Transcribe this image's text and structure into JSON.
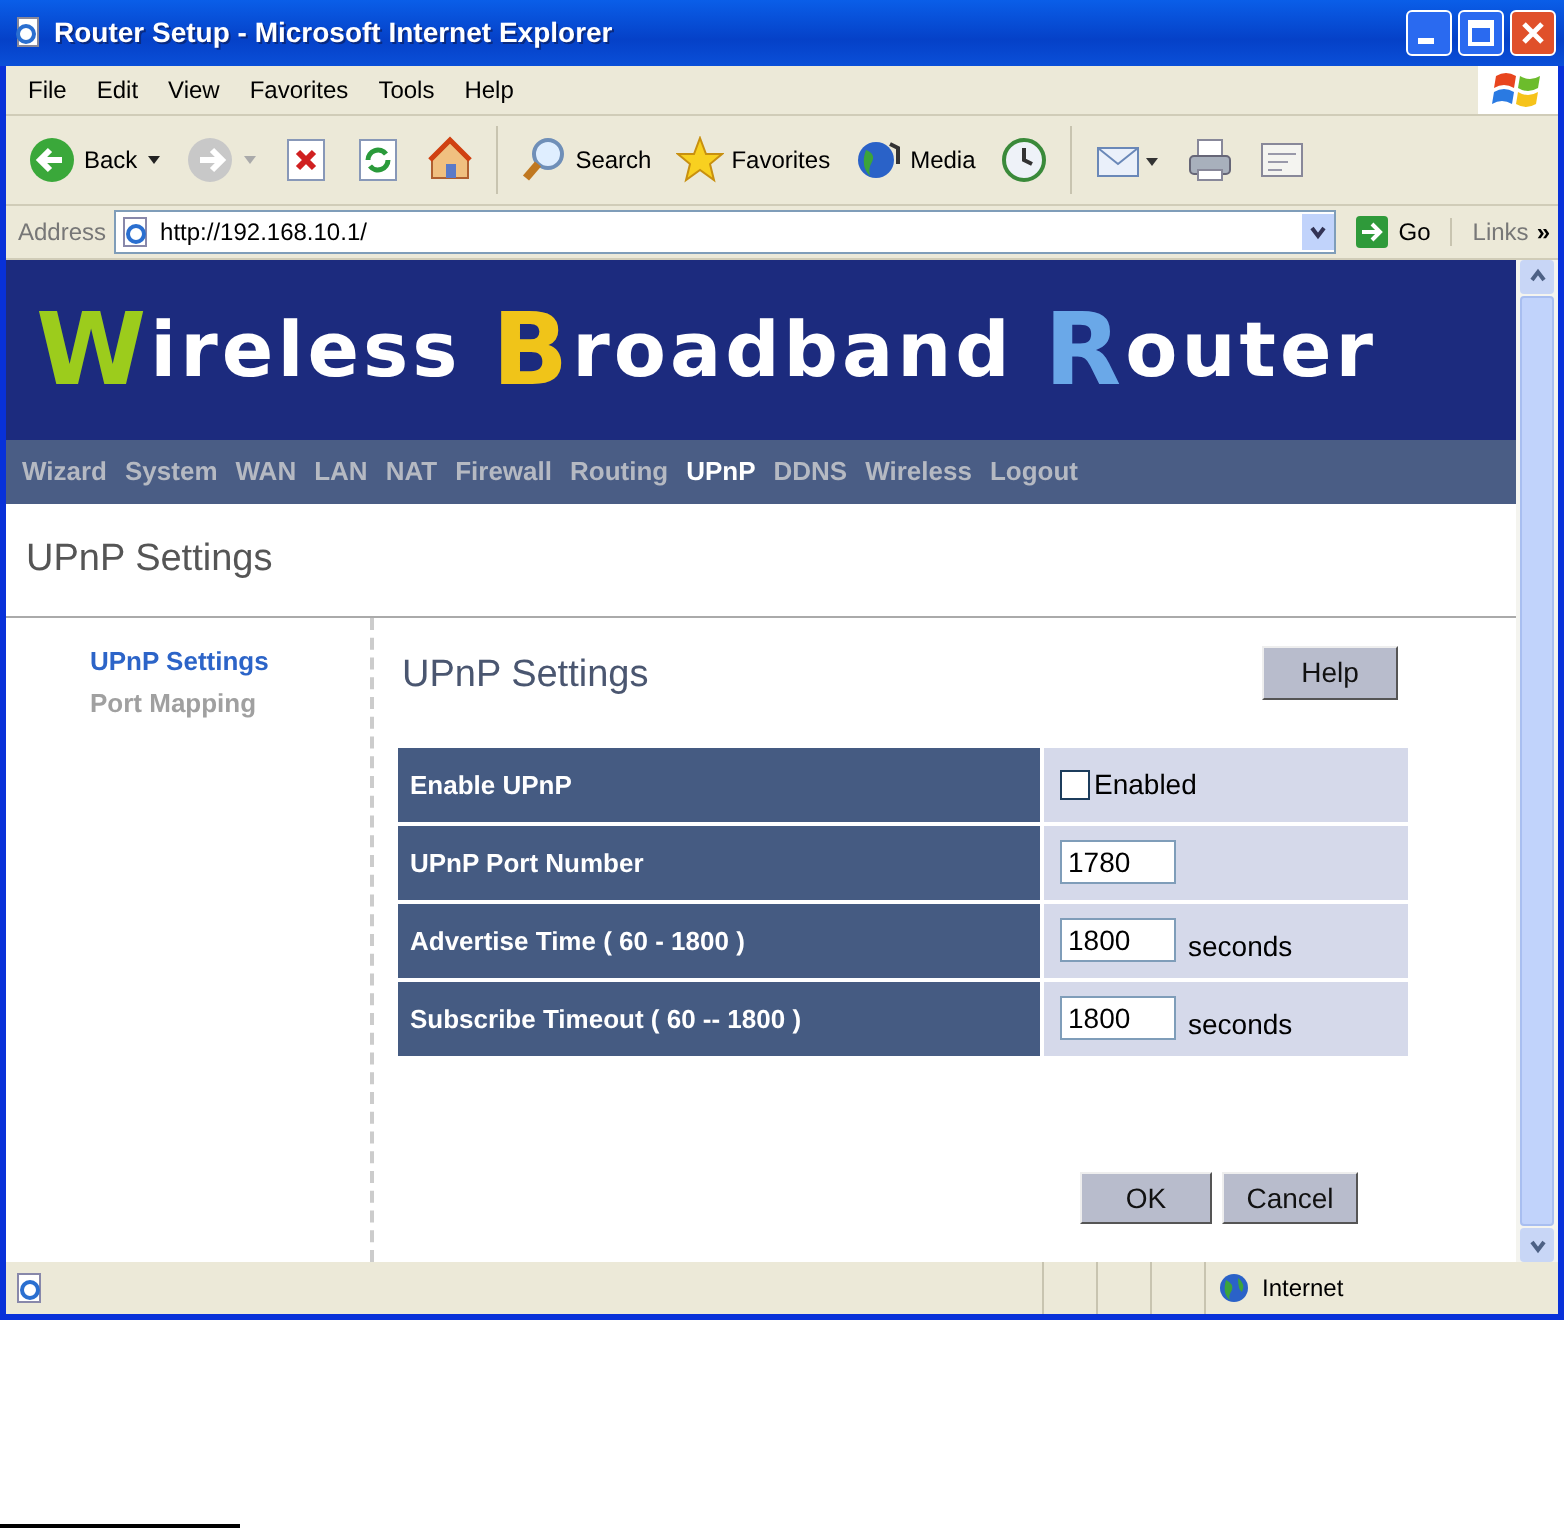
{
  "window": {
    "title": "Router Setup - Microsoft Internet Explorer"
  },
  "menu": [
    "File",
    "Edit",
    "View",
    "Favorites",
    "Tools",
    "Help"
  ],
  "toolbar": [
    {
      "kind": "back",
      "label": "Back"
    },
    {
      "kind": "forward"
    },
    {
      "kind": "stop"
    },
    {
      "kind": "refresh"
    },
    {
      "kind": "home"
    },
    {
      "kind": "search",
      "label": "Search"
    },
    {
      "kind": "favorites",
      "label": "Favorites"
    },
    {
      "kind": "media",
      "label": "Media"
    },
    {
      "kind": "history"
    },
    {
      "kind": "mail"
    },
    {
      "kind": "print"
    },
    {
      "kind": "edit"
    }
  ],
  "address": {
    "label": "Address",
    "value": "http://192.168.10.1/",
    "go": "Go",
    "links": "Links",
    "more": "»"
  },
  "banner": {
    "parts": [
      {
        "text": "W",
        "color": "#9ccc1c"
      },
      {
        "text": "ireless ",
        "color": "#ffffff"
      },
      {
        "text": "B",
        "color": "#f0c419"
      },
      {
        "text": "roadband ",
        "color": "#ffffff"
      },
      {
        "text": "R",
        "color": "#6aa8e8"
      },
      {
        "text": "outer",
        "color": "#ffffff"
      }
    ]
  },
  "nav": [
    {
      "label": "Wizard",
      "selected": false
    },
    {
      "label": "System",
      "selected": false
    },
    {
      "label": "WAN",
      "selected": false
    },
    {
      "label": "LAN",
      "selected": false
    },
    {
      "label": "NAT",
      "selected": false
    },
    {
      "label": "Firewall",
      "selected": false
    },
    {
      "label": "Routing",
      "selected": false
    },
    {
      "label": "UPnP",
      "selected": true
    },
    {
      "label": "DDNS",
      "selected": false
    },
    {
      "label": "Wireless",
      "selected": false
    },
    {
      "label": "Logout",
      "selected": false
    }
  ],
  "page_title": "UPnP Settings",
  "sidebar": {
    "items": [
      {
        "label": "UPnP Settings",
        "selected": true
      },
      {
        "label": "Port Mapping",
        "selected": false
      }
    ]
  },
  "panel": {
    "title": "UPnP Settings",
    "help": "Help",
    "rows": [
      {
        "kind": "checkbox",
        "label": "Enable UPnP",
        "checked": false,
        "option": "Enabled"
      },
      {
        "kind": "input",
        "label": "UPnP Port Number",
        "value": "1780"
      },
      {
        "kind": "input",
        "label": "Advertise Time ( 60 - 1800 )",
        "value": "1800",
        "unit": "seconds"
      },
      {
        "kind": "input",
        "label": "Subscribe Timeout ( 60 -- 1800 )",
        "value": "1800",
        "unit": "seconds"
      }
    ],
    "buttons": [
      "OK",
      "Cancel"
    ]
  },
  "status_bar": {
    "zone": "Internet"
  }
}
